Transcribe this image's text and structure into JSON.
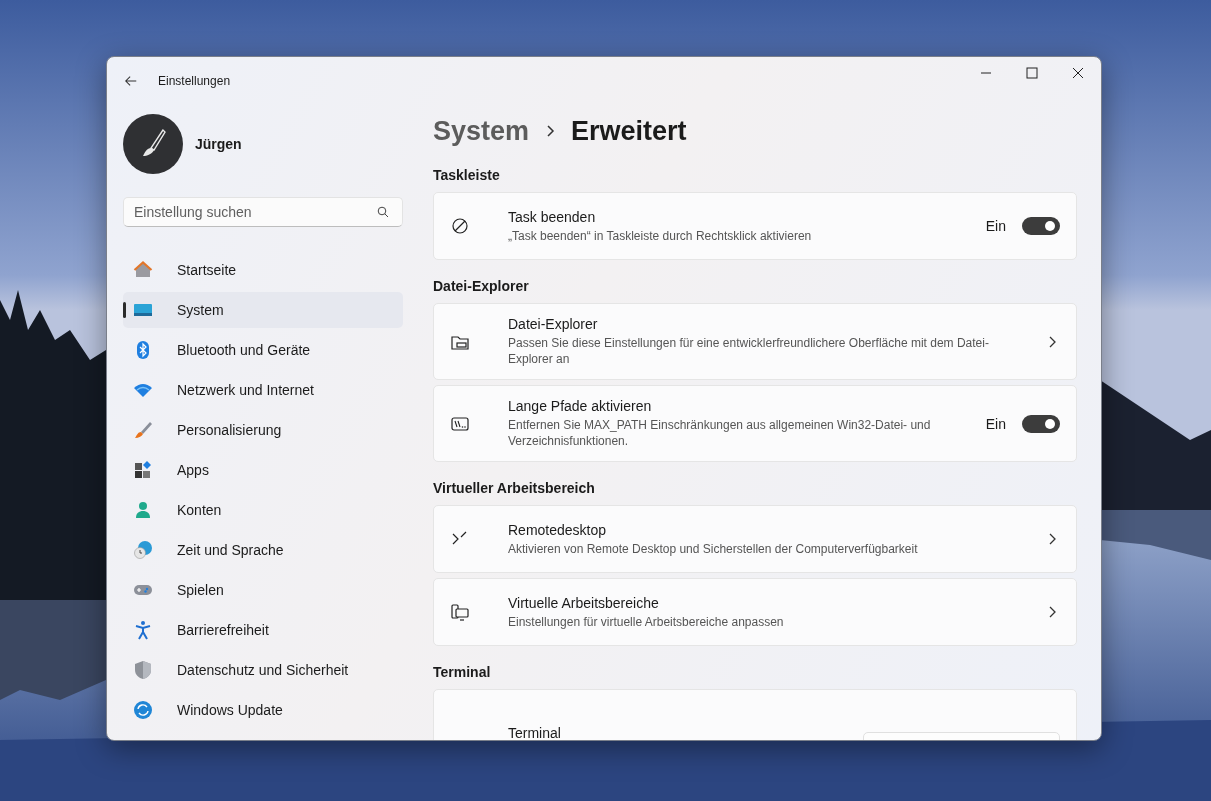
{
  "window": {
    "title": "Einstellungen"
  },
  "user": {
    "name": "Jürgen"
  },
  "search": {
    "placeholder": "Einstellung suchen"
  },
  "nav": [
    {
      "label": "Startseite",
      "selected": false
    },
    {
      "label": "System",
      "selected": true
    },
    {
      "label": "Bluetooth und Geräte",
      "selected": false
    },
    {
      "label": "Netzwerk und Internet",
      "selected": false
    },
    {
      "label": "Personalisierung",
      "selected": false
    },
    {
      "label": "Apps",
      "selected": false
    },
    {
      "label": "Konten",
      "selected": false
    },
    {
      "label": "Zeit und Sprache",
      "selected": false
    },
    {
      "label": "Spielen",
      "selected": false
    },
    {
      "label": "Barrierefreiheit",
      "selected": false
    },
    {
      "label": "Datenschutz und Sicherheit",
      "selected": false
    },
    {
      "label": "Windows Update",
      "selected": false
    }
  ],
  "breadcrumb": {
    "parent": "System",
    "current": "Erweitert"
  },
  "sections": [
    {
      "title": "Taskleiste",
      "cards": [
        {
          "kind": "toggle",
          "title": "Task beenden",
          "description": "„Task beenden“ in Taskleiste durch Rechtsklick aktivieren",
          "state_label": "Ein",
          "on": true
        }
      ]
    },
    {
      "title": "Datei-Explorer",
      "cards": [
        {
          "kind": "link",
          "title": "Datei-Explorer",
          "description": "Passen Sie diese Einstellungen für eine entwicklerfreundlichere Oberfläche mit dem Datei-Explorer an"
        },
        {
          "kind": "toggle",
          "title": "Lange Pfade aktivieren",
          "description": "Entfernen Sie MAX_PATH Einschränkungen aus allgemeinen Win32-Datei- und Verzeichnisfunktionen.",
          "state_label": "Ein",
          "on": true
        }
      ]
    },
    {
      "title": "Virtueller Arbeitsbereich",
      "cards": [
        {
          "kind": "link",
          "title": "Remotedesktop",
          "description": "Aktivieren von Remote Desktop und Sicherstellen der Computerverfügbarkeit"
        },
        {
          "kind": "link",
          "title": "Virtuelle Arbeitsbereiche",
          "description": "Einstellungen für virtuelle Arbeitsbereiche anpassen"
        }
      ]
    },
    {
      "title": "Terminal",
      "cards": [
        {
          "kind": "dropdown",
          "title": "Terminal"
        }
      ]
    }
  ]
}
